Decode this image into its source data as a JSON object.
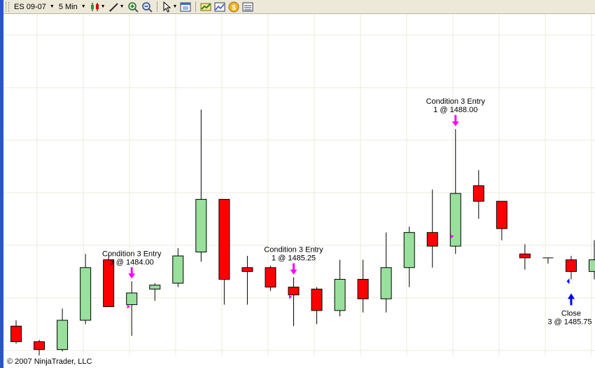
{
  "toolbar": {
    "instrument": "ES 09-07",
    "interval": "5 Min",
    "icons": [
      "candlestick-chart-icon",
      "pencil-draw-icon",
      "zoom-in-icon",
      "zoom-out-icon",
      "cursor-pointer-icon",
      "chart-properties-icon",
      "indicators-icon",
      "strategies-icon",
      "coin-icon",
      "data-box-icon"
    ]
  },
  "colors": {
    "up": "#98e09b",
    "down": "#ff0000",
    "entry_marker": "#ff00ff",
    "exit_marker": "#0000ff",
    "grid": "#ebebdd",
    "toolbar_bg": "#ece9d8"
  },
  "chart_data": {
    "type": "candlestick",
    "instrument": "ES 09-07",
    "interval": "5 Min",
    "grid": true,
    "ylim": [
      1480.5,
      1489.25
    ],
    "candles": [
      {
        "open": 1481.25,
        "high": 1481.4,
        "low": 1480.8,
        "close": 1480.85
      },
      {
        "open": 1480.85,
        "high": 1480.9,
        "low": 1480.5,
        "close": 1480.65
      },
      {
        "open": 1480.65,
        "high": 1481.7,
        "low": 1480.6,
        "close": 1481.4
      },
      {
        "open": 1481.4,
        "high": 1483.1,
        "low": 1481.3,
        "close": 1482.75
      },
      {
        "open": 1482.95,
        "high": 1483.1,
        "low": 1481.75,
        "close": 1481.75
      },
      {
        "open": 1481.8,
        "high": 1482.4,
        "low": 1481.0,
        "close": 1482.1
      },
      {
        "open": 1482.2,
        "high": 1482.35,
        "low": 1481.9,
        "close": 1482.3
      },
      {
        "open": 1482.35,
        "high": 1483.25,
        "low": 1482.25,
        "close": 1483.05
      },
      {
        "open": 1483.15,
        "high": 1486.8,
        "low": 1482.9,
        "close": 1484.5
      },
      {
        "open": 1484.5,
        "high": 1484.5,
        "low": 1481.8,
        "close": 1482.45
      },
      {
        "open": 1482.75,
        "high": 1483.05,
        "low": 1481.8,
        "close": 1482.65
      },
      {
        "open": 1482.75,
        "high": 1482.8,
        "low": 1482.15,
        "close": 1482.25
      },
      {
        "open": 1482.25,
        "high": 1482.5,
        "low": 1481.25,
        "close": 1482.05
      },
      {
        "open": 1482.2,
        "high": 1482.25,
        "low": 1481.3,
        "close": 1481.65
      },
      {
        "open": 1481.65,
        "high": 1482.95,
        "low": 1481.5,
        "close": 1482.45
      },
      {
        "open": 1482.45,
        "high": 1482.95,
        "low": 1481.6,
        "close": 1481.95
      },
      {
        "open": 1481.95,
        "high": 1483.65,
        "low": 1481.6,
        "close": 1482.75
      },
      {
        "open": 1482.75,
        "high": 1483.8,
        "low": 1482.25,
        "close": 1483.65
      },
      {
        "open": 1483.65,
        "high": 1484.75,
        "low": 1482.75,
        "close": 1483.3
      },
      {
        "open": 1483.3,
        "high": 1486.3,
        "low": 1483.1,
        "close": 1484.65
      },
      {
        "open": 1484.85,
        "high": 1485.25,
        "low": 1484.0,
        "close": 1484.45
      },
      {
        "open": 1484.45,
        "high": 1484.25,
        "low": 1483.45,
        "close": 1483.75
      },
      {
        "open": 1483.1,
        "high": 1483.35,
        "low": 1482.7,
        "close": 1483.0
      },
      {
        "open": 1483.0,
        "high": 1483.0,
        "low": 1482.85,
        "close": 1483.0
      },
      {
        "open": 1482.95,
        "high": 1483.05,
        "low": 1482.45,
        "close": 1482.65
      },
      {
        "open": 1482.65,
        "high": 1483.45,
        "low": 1482.45,
        "close": 1482.95
      }
    ],
    "annotations": [
      {
        "index": 5,
        "side": "entry",
        "label": "Condition 3 Entry",
        "detail": "3 @ 1484.00",
        "marker_price": 1481.75
      },
      {
        "index": 12,
        "side": "entry",
        "label": "Condition 3 Entry",
        "detail": "1 @ 1485.25",
        "marker_price": 1482.0
      },
      {
        "index": 19,
        "side": "entry",
        "label": "Condition 3 Entry",
        "detail": "1 @ 1488.00",
        "marker_price": 1483.55
      },
      {
        "index": 24,
        "side": "exit",
        "label": "Close",
        "detail": "3 @ 1485.75",
        "marker_price": 1482.4
      }
    ]
  },
  "footer": {
    "copyright": "© 2007 NinjaTrader, LLC"
  }
}
